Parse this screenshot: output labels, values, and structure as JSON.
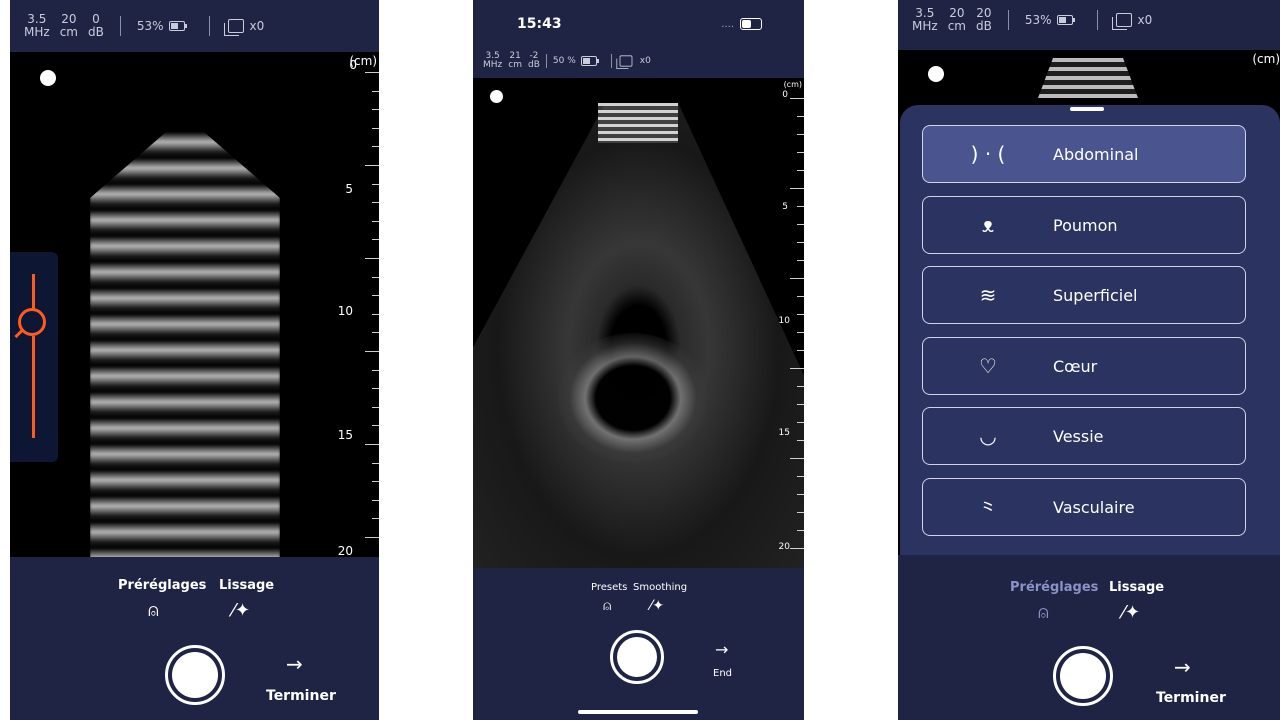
{
  "screens": [
    {
      "status": {
        "freq": "3.5",
        "freq_unit": "MHz",
        "depth": "20",
        "depth_unit": "cm",
        "gain": "0",
        "gain_unit": "dB",
        "battery": "53%",
        "images": "x0"
      },
      "ruler": {
        "unit": "(cm)",
        "labels": [
          "0",
          "5",
          "10",
          "15",
          "20"
        ]
      },
      "controls": {
        "presets_label": "Préréglages",
        "smoothing_label": "Lissage",
        "end_label": "Terminer",
        "presets_icon": "person-icon",
        "smoothing_icon": "magic-wand-icon",
        "end_icon": "arrow-right-icon"
      },
      "accent_color": "#ff5a1f"
    },
    {
      "ios": {
        "time": "15:43",
        "signal": "....",
        "battery_icon": "battery-icon"
      },
      "status": {
        "freq": "3.5",
        "freq_unit": "MHz",
        "depth": "21",
        "depth_unit": "cm",
        "gain": "-2",
        "gain_unit": "dB",
        "battery": "50 %",
        "images": "x0"
      },
      "ruler": {
        "unit": "(cm)",
        "labels": [
          "0",
          "5",
          "10",
          "15",
          "20"
        ]
      },
      "controls": {
        "presets_label": "Presets",
        "smoothing_label": "Smoothing",
        "end_label": "End",
        "presets_icon": "person-icon",
        "smoothing_icon": "magic-wand-icon",
        "end_icon": "arrow-right-icon"
      }
    },
    {
      "status": {
        "freq": "3.5",
        "freq_unit": "MHz",
        "depth": "20",
        "depth_unit": "cm",
        "gain": "20",
        "gain_unit": "dB",
        "battery": "53%",
        "images": "x0"
      },
      "ruler": {
        "unit": "(cm)"
      },
      "presets": [
        {
          "label": "Abdominal",
          "icon": "abdomen-icon",
          "glyph": ") · (",
          "active": true
        },
        {
          "label": "Poumon",
          "icon": "lungs-icon",
          "glyph": "🫁",
          "active": false
        },
        {
          "label": "Superficiel",
          "icon": "layers-icon",
          "glyph": "≋",
          "active": false
        },
        {
          "label": "Cœur",
          "icon": "heart-icon",
          "glyph": "♡",
          "active": false
        },
        {
          "label": "Vessie",
          "icon": "bladder-icon",
          "glyph": "◡",
          "active": false
        },
        {
          "label": "Vasculaire",
          "icon": "vessels-icon",
          "glyph": "⺀",
          "active": false
        }
      ],
      "controls": {
        "presets_label": "Préréglages",
        "smoothing_label": "Lissage",
        "end_label": "Terminer",
        "presets_icon": "person-icon",
        "smoothing_icon": "magic-wand-icon",
        "end_icon": "arrow-right-icon"
      }
    }
  ]
}
